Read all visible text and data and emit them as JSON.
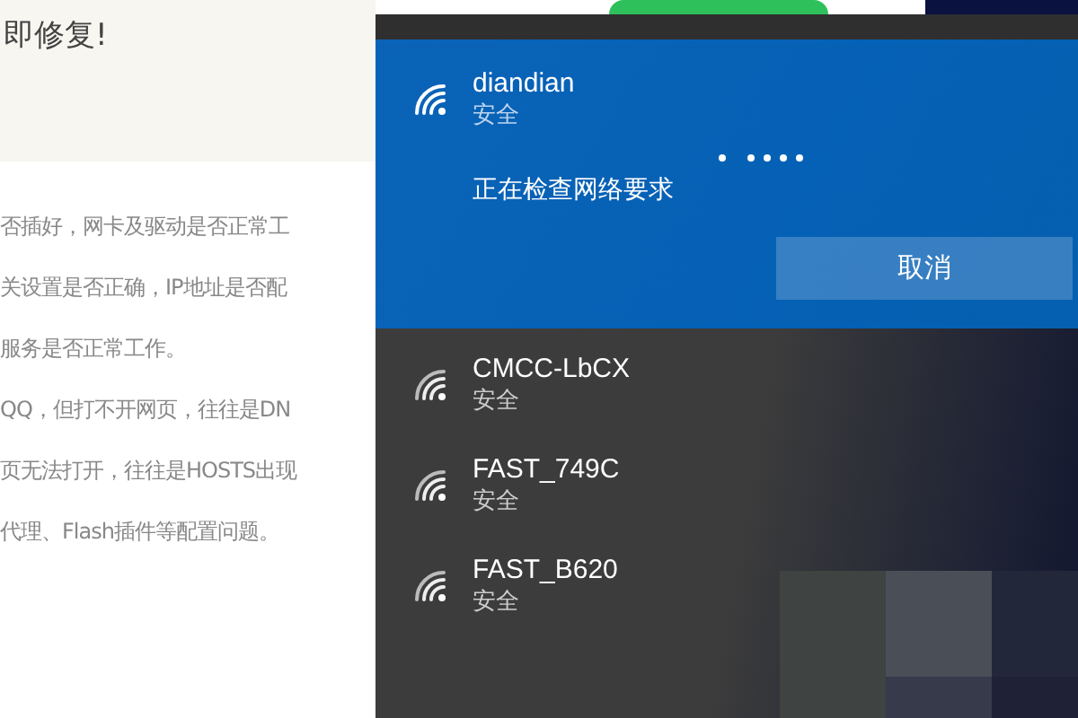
{
  "article": {
    "title": "即修复!",
    "lines": [
      "否插好，网卡及驱动是否正常工",
      "关设置是否正确，IP地址是否配",
      "服务是否正常工作。",
      "QQ，但打不开网页，往往是DN",
      "页无法打开，往往是HOSTS出现",
      "代理、Flash插件等配置问题。"
    ]
  },
  "flyout": {
    "connecting": {
      "name": "diandian",
      "security": "安全",
      "status": "正在检查网络要求",
      "cancel_button": "取消"
    },
    "networks": [
      {
        "name": "CMCC-LbCX",
        "security": "安全"
      },
      {
        "name": "FAST_749C",
        "security": "安全"
      },
      {
        "name": "FAST_B620",
        "security": "安全"
      }
    ]
  }
}
